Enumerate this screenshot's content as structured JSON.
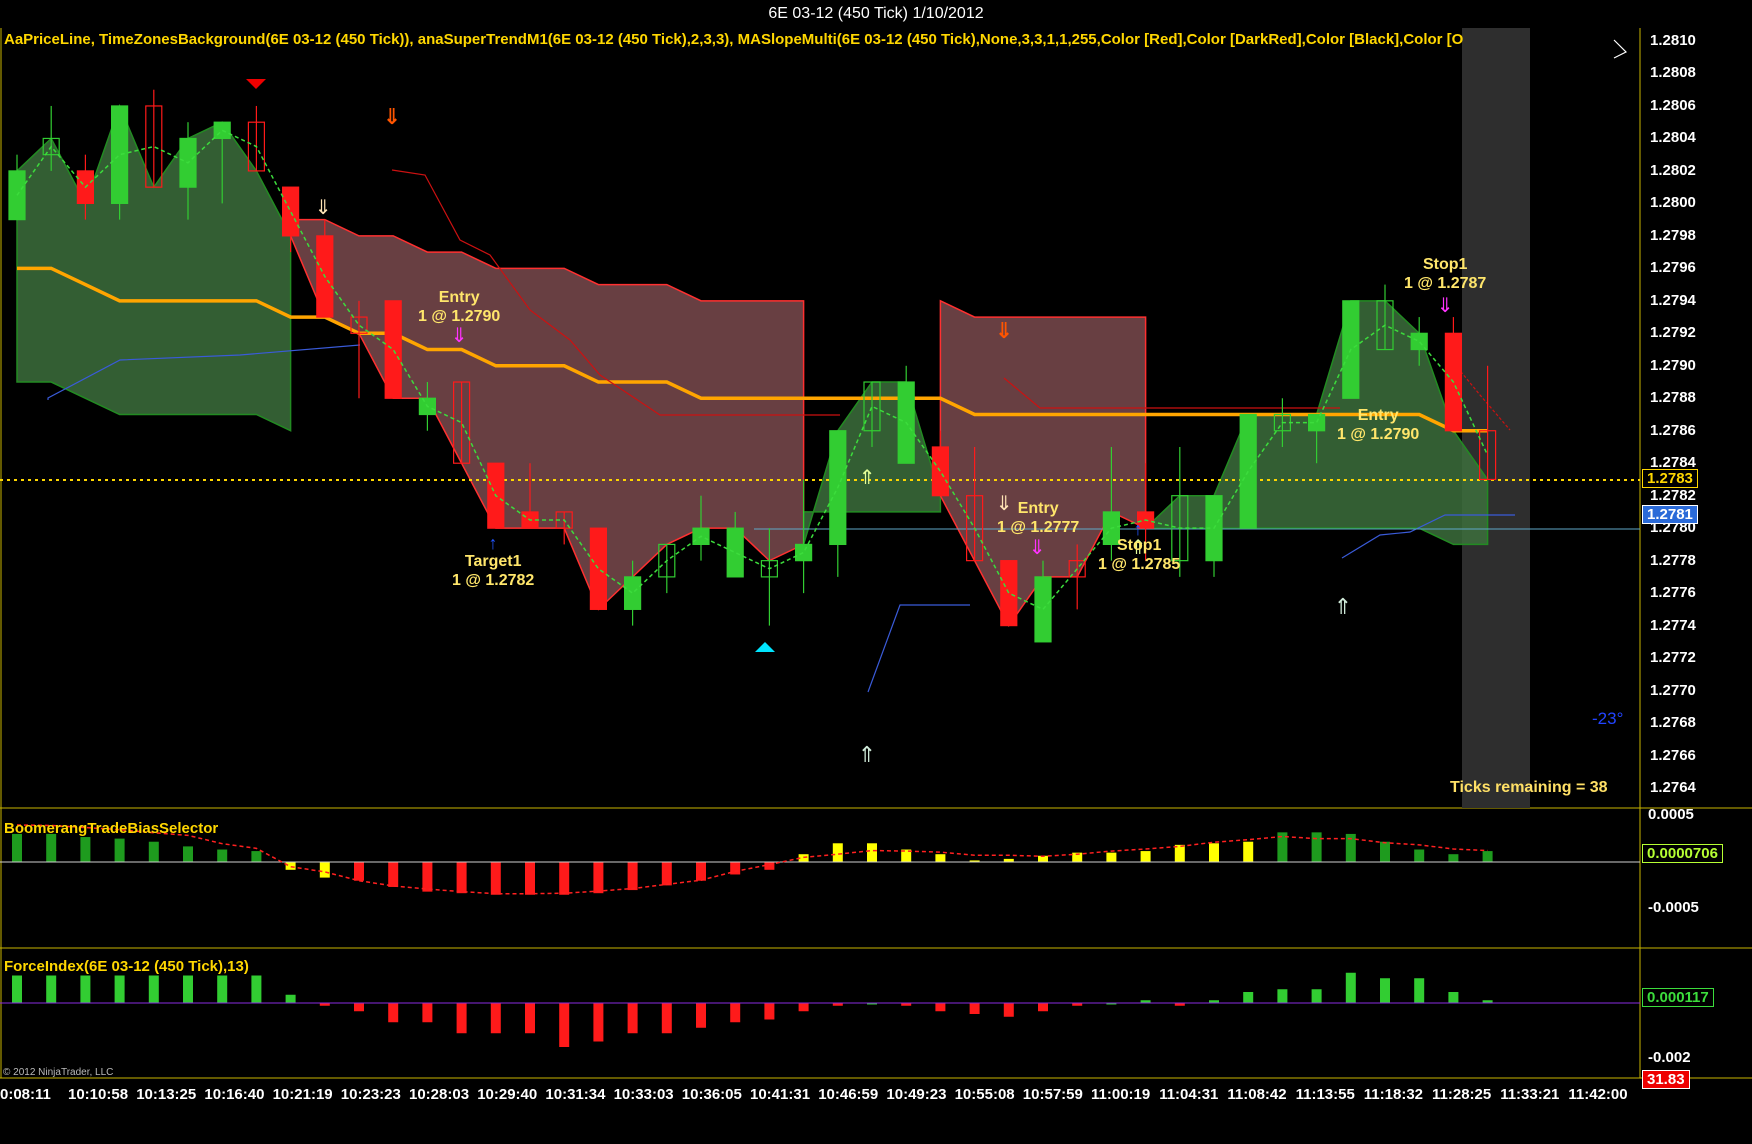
{
  "window": {
    "title": "6E 03-12 (450 Tick)  1/10/2012"
  },
  "colors": {
    "bg": "#000000",
    "up": "#32cd32",
    "down": "#ff1a1a",
    "band_up": "#3c6e3c",
    "band_down": "#7a4a4e",
    "ma": "#ffa500",
    "cyan": "#00ffff",
    "yellow": "#ffff00",
    "frame": "#ffd700"
  },
  "price_panel": {
    "header": "AaPriceLine,  TimeZonesBackground(6E  03-12  (450  Tick)),  anaSuperTrendM1(6E  03-12  (450  Tick),2,3,3),  MASlopeMulti(6E  03-12  (450  Tick),None,3,3,1,1,255,Color  [Red],Color  [DarkRed],Color  [Black],Color  [O",
    "ticks": [
      "1.2810",
      "1.2808",
      "1.2806",
      "1.2804",
      "1.2802",
      "1.2800",
      "1.2798",
      "1.2796",
      "1.2794",
      "1.2792",
      "1.2790",
      "1.2788",
      "1.2786",
      "1.2784",
      "1.2782",
      "1.2780",
      "1.2778",
      "1.2776",
      "1.2774",
      "1.2772",
      "1.2770",
      "1.2768",
      "1.2766",
      "1.2764"
    ],
    "last_price_tag": "1.2783",
    "bid_tag": "1.2781",
    "ticks_remaining": "Ticks remaining = 38",
    "slope_label": "-23°",
    "annotations": [
      {
        "line1": "Entry",
        "line2": "1 @ 1.2790"
      },
      {
        "line1": "Target1",
        "line2": "1 @ 1.2782"
      },
      {
        "line1": "Entry",
        "line2": "1 @ 1.2777"
      },
      {
        "line1": "Stop1",
        "line2": "1 @ 1.2785"
      },
      {
        "line1": "Entry",
        "line2": "1 @ 1.2790"
      },
      {
        "line1": "Stop1",
        "line2": "1 @ 1.2787"
      }
    ]
  },
  "boomerang_panel": {
    "title": "BoomerangTradeBiasSelector",
    "ticks": [
      "0.0005",
      "-0.0005"
    ],
    "value_tag": "0.0000706"
  },
  "force_panel": {
    "title": "ForceIndex(6E 03-12 (450 Tick),13)",
    "ticks": [
      "-0.002"
    ],
    "value_tag": "0.000117",
    "extra_tag": "31.83",
    "copyright": "© 2012 NinjaTrader, LLC"
  },
  "time_axis": [
    "0:08:11",
    "10:10:58",
    "10:13:25",
    "10:16:40",
    "10:21:19",
    "10:23:23",
    "10:28:03",
    "10:29:40",
    "10:31:34",
    "10:33:03",
    "10:36:05",
    "10:41:31",
    "10:46:59",
    "10:49:23",
    "10:55:08",
    "10:57:59",
    "11:00:19",
    "11:04:31",
    "11:08:42",
    "11:13:55",
    "11:18:32",
    "11:28:25",
    "11:33:21",
    "11:42:00"
  ],
  "chart_data": {
    "type": "candlestick",
    "y_range": [
      1.2763,
      1.2811
    ],
    "candles": [
      {
        "o": 1.2799,
        "h": 1.2803,
        "l": 1.2799,
        "c": 1.2802
      },
      {
        "o": 1.2803,
        "h": 1.2806,
        "l": 1.2802,
        "c": 1.2804
      },
      {
        "o": 1.2802,
        "h": 1.2803,
        "l": 1.2799,
        "c": 1.28
      },
      {
        "o": 1.28,
        "h": 1.2806,
        "l": 1.2799,
        "c": 1.2806
      },
      {
        "o": 1.2806,
        "h": 1.2807,
        "l": 1.2801,
        "c": 1.2801
      },
      {
        "o": 1.2801,
        "h": 1.2805,
        "l": 1.2799,
        "c": 1.2804
      },
      {
        "o": 1.2804,
        "h": 1.2805,
        "l": 1.28,
        "c": 1.2805
      },
      {
        "o": 1.2805,
        "h": 1.2806,
        "l": 1.2802,
        "c": 1.2802
      },
      {
        "o": 1.2801,
        "h": 1.2801,
        "l": 1.2797,
        "c": 1.2798
      },
      {
        "o": 1.2798,
        "h": 1.2799,
        "l": 1.2793,
        "c": 1.2793
      },
      {
        "o": 1.2793,
        "h": 1.2794,
        "l": 1.2788,
        "c": 1.2792
      },
      {
        "o": 1.2794,
        "h": 1.2794,
        "l": 1.2788,
        "c": 1.2788
      },
      {
        "o": 1.2787,
        "h": 1.2789,
        "l": 1.2786,
        "c": 1.2788
      },
      {
        "o": 1.2789,
        "h": 1.2789,
        "l": 1.2784,
        "c": 1.2784
      },
      {
        "o": 1.2784,
        "h": 1.2784,
        "l": 1.278,
        "c": 1.278
      },
      {
        "o": 1.2781,
        "h": 1.2784,
        "l": 1.278,
        "c": 1.278
      },
      {
        "o": 1.2781,
        "h": 1.2781,
        "l": 1.2779,
        "c": 1.278
      },
      {
        "o": 1.278,
        "h": 1.278,
        "l": 1.2775,
        "c": 1.2775
      },
      {
        "o": 1.2775,
        "h": 1.2778,
        "l": 1.2774,
        "c": 1.2777
      },
      {
        "o": 1.2777,
        "h": 1.2779,
        "l": 1.2776,
        "c": 1.2779
      },
      {
        "o": 1.2779,
        "h": 1.2782,
        "l": 1.2778,
        "c": 1.278
      },
      {
        "o": 1.2777,
        "h": 1.2781,
        "l": 1.2777,
        "c": 1.278
      },
      {
        "o": 1.2777,
        "h": 1.278,
        "l": 1.2774,
        "c": 1.2778
      },
      {
        "o": 1.2778,
        "h": 1.2783,
        "l": 1.2776,
        "c": 1.2779
      },
      {
        "o": 1.2779,
        "h": 1.2786,
        "l": 1.2777,
        "c": 1.2786
      },
      {
        "o": 1.2786,
        "h": 1.2789,
        "l": 1.2785,
        "c": 1.2789
      },
      {
        "o": 1.2784,
        "h": 1.279,
        "l": 1.2784,
        "c": 1.2789
      },
      {
        "o": 1.2785,
        "h": 1.2786,
        "l": 1.2782,
        "c": 1.2782
      },
      {
        "o": 1.2782,
        "h": 1.2785,
        "l": 1.2778,
        "c": 1.2778
      },
      {
        "o": 1.2778,
        "h": 1.2778,
        "l": 1.2774,
        "c": 1.2774
      },
      {
        "o": 1.2773,
        "h": 1.2778,
        "l": 1.2773,
        "c": 1.2777
      },
      {
        "o": 1.2778,
        "h": 1.2779,
        "l": 1.2775,
        "c": 1.2777
      },
      {
        "o": 1.2779,
        "h": 1.2785,
        "l": 1.2778,
        "c": 1.2781
      },
      {
        "o": 1.2781,
        "h": 1.2784,
        "l": 1.2778,
        "c": 1.278
      },
      {
        "o": 1.2778,
        "h": 1.2785,
        "l": 1.2777,
        "c": 1.2782
      },
      {
        "o": 1.2778,
        "h": 1.2782,
        "l": 1.2777,
        "c": 1.2782
      },
      {
        "o": 1.278,
        "h": 1.2787,
        "l": 1.278,
        "c": 1.2787
      },
      {
        "o": 1.2786,
        "h": 1.2788,
        "l": 1.2785,
        "c": 1.2787
      },
      {
        "o": 1.2786,
        "h": 1.2787,
        "l": 1.2784,
        "c": 1.2787
      },
      {
        "o": 1.2788,
        "h": 1.2794,
        "l": 1.2788,
        "c": 1.2794
      },
      {
        "o": 1.2791,
        "h": 1.2795,
        "l": 1.2791,
        "c": 1.2794
      },
      {
        "o": 1.2791,
        "h": 1.2793,
        "l": 1.279,
        "c": 1.2792
      },
      {
        "o": 1.2792,
        "h": 1.2793,
        "l": 1.2786,
        "c": 1.2786
      },
      {
        "o": 1.2786,
        "h": 1.279,
        "l": 1.2783,
        "c": 1.2783
      }
    ],
    "moving_average": [
      1.2796,
      1.2796,
      1.2795,
      1.2794,
      1.2794,
      1.2794,
      1.2794,
      1.2794,
      1.2793,
      1.2793,
      1.2792,
      1.2792,
      1.2791,
      1.2791,
      1.279,
      1.279,
      1.279,
      1.2789,
      1.2789,
      1.2789,
      1.2788,
      1.2788,
      1.2788,
      1.2788,
      1.2788,
      1.2788,
      1.2788,
      1.2788,
      1.2787,
      1.2787,
      1.2787,
      1.2787,
      1.2787,
      1.2787,
      1.2787,
      1.2787,
      1.2787,
      1.2787,
      1.2787,
      1.2787,
      1.2787,
      1.2787,
      1.2786,
      1.2786
    ],
    "boomerang_histogram": [
      0.00018,
      0.00018,
      0.00016,
      0.00015,
      0.00013,
      0.0001,
      8e-05,
      7e-05,
      -5e-05,
      -0.0001,
      -0.00012,
      -0.00016,
      -0.00019,
      -0.0002,
      -0.00021,
      -0.00021,
      -0.00021,
      -0.0002,
      -0.00018,
      -0.00015,
      -0.00012,
      -8e-05,
      -5e-05,
      5e-05,
      0.00012,
      0.00012,
      8e-05,
      5e-05,
      1e-05,
      2e-05,
      4e-05,
      6e-05,
      6e-05,
      7e-05,
      0.00011,
      0.00012,
      0.00013,
      0.00019,
      0.00019,
      0.00018,
      0.00013,
      8e-05,
      5e-05,
      7e-05
    ],
    "force_histogram": [
      0.001,
      0.001,
      0.001,
      0.001,
      0.001,
      0.001,
      0.001,
      0.001,
      0.0003,
      -0.0001,
      -0.0003,
      -0.0007,
      -0.0007,
      -0.0011,
      -0.0011,
      -0.0011,
      -0.0016,
      -0.0014,
      -0.0011,
      -0.0011,
      -0.0009,
      -0.0007,
      -0.0006,
      -0.0003,
      -0.0001,
      0.0,
      -0.0001,
      -0.0003,
      -0.0004,
      -0.0005,
      -0.0003,
      -0.0001,
      0.0,
      0.0001,
      -0.0001,
      0.0001,
      0.0004,
      0.0005,
      0.0005,
      0.0011,
      0.0009,
      0.0009,
      0.0004,
      0.0001
    ]
  }
}
